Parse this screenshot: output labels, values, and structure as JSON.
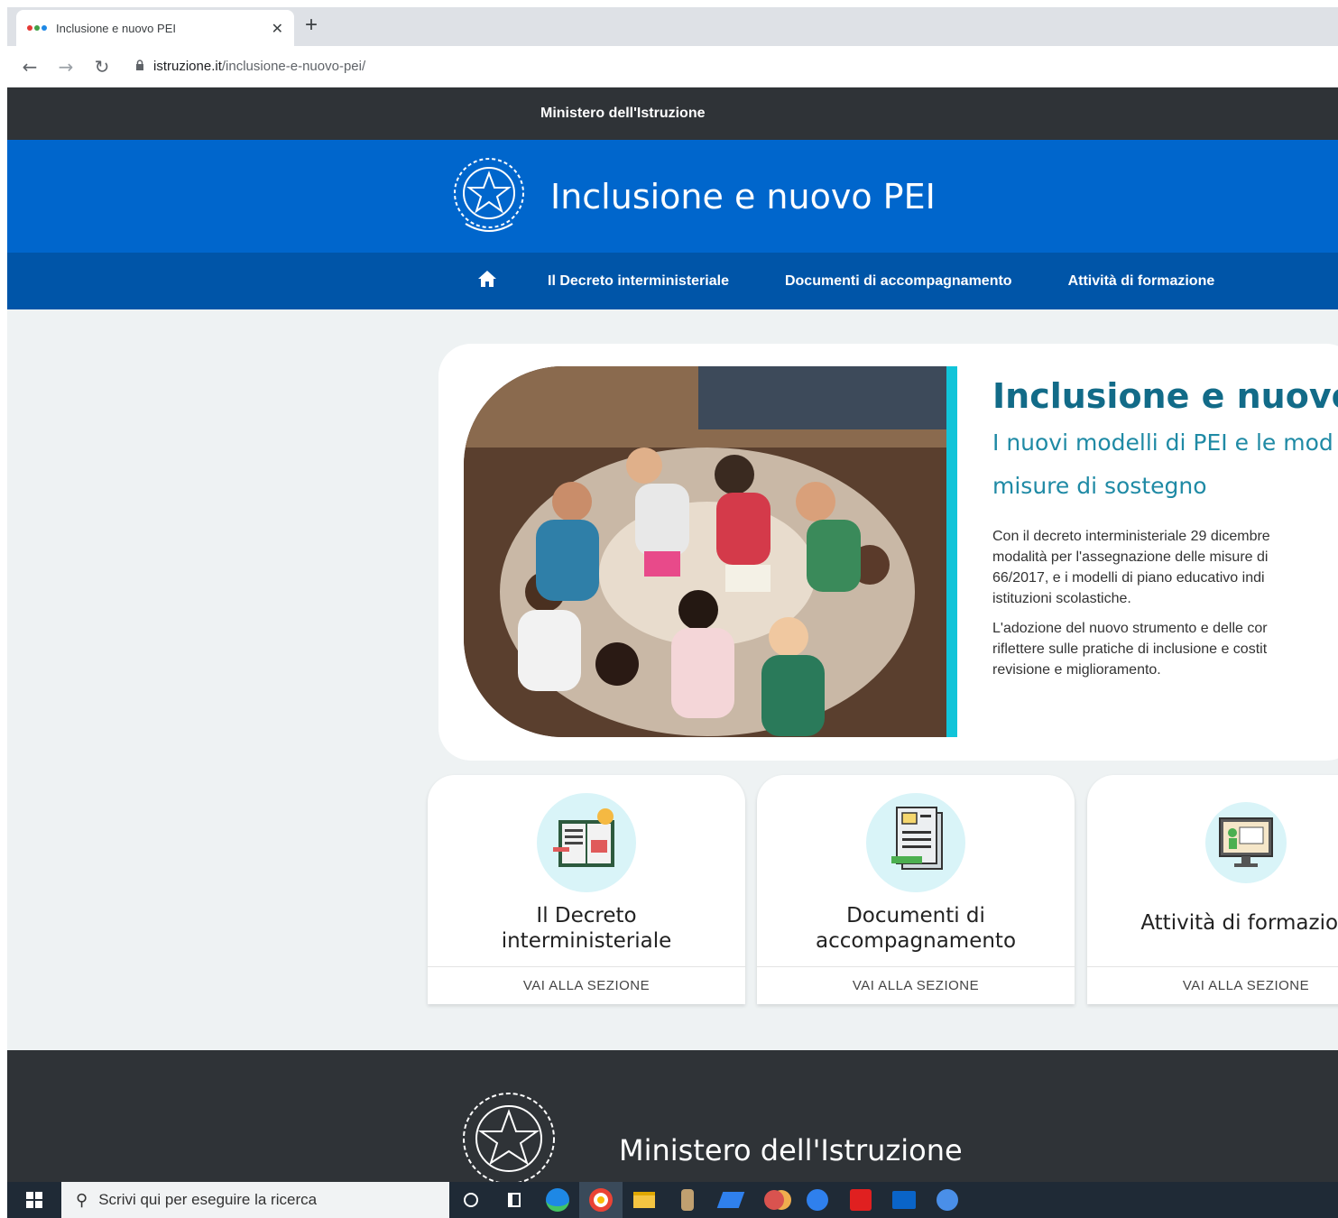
{
  "browser": {
    "tab_title": "Inclusione e nuovo PEI",
    "tab_close": "✕",
    "new_tab": "+",
    "url_host": "istruzione.it",
    "url_path": "/inclusione-e-nuovo-pei/"
  },
  "site": {
    "top_label": "Ministero dell'Istruzione",
    "brand_title": "Inclusione e nuovo PEI",
    "nav": [
      {
        "label": "Il Decreto interministeriale"
      },
      {
        "label": "Documenti di accompagnamento"
      },
      {
        "label": "Attività di formazione"
      }
    ]
  },
  "hero": {
    "title": "Inclusione e nuovo",
    "subtitle_line1": "I nuovi modelli di PEI e le mod",
    "subtitle_line2": "misure di sostegno",
    "p1": [
      "Con il decreto interministeriale 29 dicembre",
      "modalità per l'assegnazione delle misure di",
      "66/2017, e i modelli di piano educativo indi",
      "istituzioni scolastiche."
    ],
    "p2": [
      "L'adozione del nuovo strumento e delle cor",
      "riflettere sulle pratiche di inclusione e costit",
      "revisione e miglioramento."
    ]
  },
  "cards": [
    {
      "title_line1": "Il Decreto",
      "title_line2": "interministeriale",
      "cta": "VAI ALLA SEZIONE"
    },
    {
      "title_line1": "Documenti di",
      "title_line2": "accompagnamento",
      "cta": "VAI ALLA SEZIONE"
    },
    {
      "title_line1": "Attività di formazion",
      "title_line2": "",
      "cta": "VAI ALLA SEZIONE"
    }
  ],
  "footer": {
    "title": "Ministero dell'Istruzione"
  },
  "taskbar": {
    "search_placeholder": "Scrivi qui per eseguire la ricerca"
  },
  "colors": {
    "brand_blue": "#0066cc",
    "nav_blue": "#0055a8",
    "dark": "#2f3337",
    "accent_cyan": "#11c4d9",
    "heading_teal": "#126b88"
  }
}
